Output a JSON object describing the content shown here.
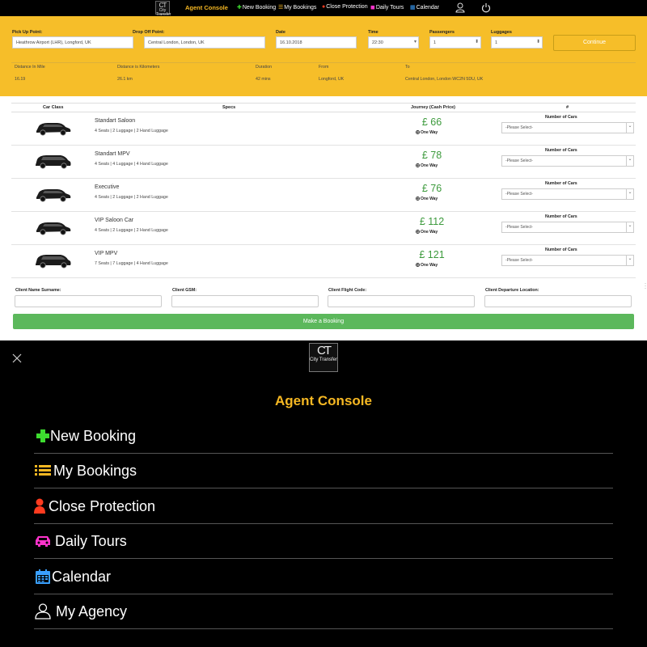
{
  "brand": {
    "logo_text": "CT",
    "logo_sub": "City Transfer"
  },
  "nav": {
    "title": "Agent Console",
    "items": [
      {
        "label": "New Booking",
        "icon": "plus-icon",
        "color": "#3ddc2f"
      },
      {
        "label": "My Bookings",
        "icon": "list-icon",
        "color": "#f6b823"
      },
      {
        "label": "Close Protection",
        "icon": "user-icon",
        "color": "#ff3b1f"
      },
      {
        "label": "Daily Tours",
        "icon": "car-icon",
        "color": "#ff33cc"
      },
      {
        "label": "Calendar",
        "icon": "calendar-icon",
        "color": "#3aa0ff"
      }
    ]
  },
  "search": {
    "pickup_label": "Pick Up Point:",
    "pickup_value": "Heathrow Airport (LHR), Longford, UK",
    "dropoff_label": "Drop Off Point:",
    "dropoff_value": "Central London, London, UK",
    "date_label": "Date",
    "date_value": "16.10.2018",
    "time_label": "Time",
    "time_value": "22:30",
    "passengers_label": "Passengers",
    "passengers_value": "1",
    "luggages_label": "Luggages",
    "luggages_value": "1",
    "continue_label": "Continue"
  },
  "trip_info": {
    "headers": [
      "Distance In Mile",
      "Distance is Kilometers",
      "Duration",
      "From",
      "To"
    ],
    "values": [
      "16.19",
      "26.1 km",
      "42 mins",
      "Longford, UK",
      "Central London, London WC2N 5DU, UK"
    ]
  },
  "table": {
    "headers": [
      "Car Class",
      "Specs",
      "Journey (Cash Price)",
      "#"
    ],
    "number_of_cars_label": "Number of Cars",
    "select_placeholder": "-Please Select-",
    "one_way_label": "One Way",
    "rows": [
      {
        "name": "Standart Saloon",
        "specs": "4 Seats | 2 Luggage | 2 Hand Luggage",
        "price": "£ 66"
      },
      {
        "name": "Standart MPV",
        "specs": "4 Seats | 4 Luggage | 4 Hand Luggage",
        "price": "£ 78"
      },
      {
        "name": "Executive",
        "specs": "4 Seats | 2 Luggage | 2 Hand Luggage",
        "price": "£ 76"
      },
      {
        "name": "VIP Saloon Car",
        "specs": "4 Seats | 2 Luggage | 2 Hand Luggage",
        "price": "£ 112"
      },
      {
        "name": "VIP MPV",
        "specs": "7 Seats | 7 Luggage | 4 Hand Luggage",
        "price": "£ 121"
      }
    ]
  },
  "client": {
    "name_label": "Client Name Surname:",
    "gsm_label": "Client GSM:",
    "flight_label": "Client Flight Code:",
    "departure_label": "Client Departure Location:"
  },
  "book_label": "Make a Booking",
  "menu": {
    "title": "Agent Console",
    "items": [
      {
        "label": "New Booking",
        "icon": "plus-icon",
        "color": "#3ddc2f"
      },
      {
        "label": "My Bookings",
        "icon": "list-icon",
        "color": "#f6b823"
      },
      {
        "label": "Close Protection",
        "icon": "user-icon",
        "color": "#ff3b1f"
      },
      {
        "label": "Daily Tours",
        "icon": "car-icon",
        "color": "#ff33cc"
      },
      {
        "label": "Calendar",
        "icon": "calendar-icon",
        "color": "#3aa0ff"
      },
      {
        "label": "My Agency",
        "icon": "user-outline-icon",
        "color": "#ffffff"
      }
    ]
  },
  "colors": {
    "accent": "#f6be29",
    "price_green": "#3c9a3c",
    "book_green": "#5cb85c"
  }
}
